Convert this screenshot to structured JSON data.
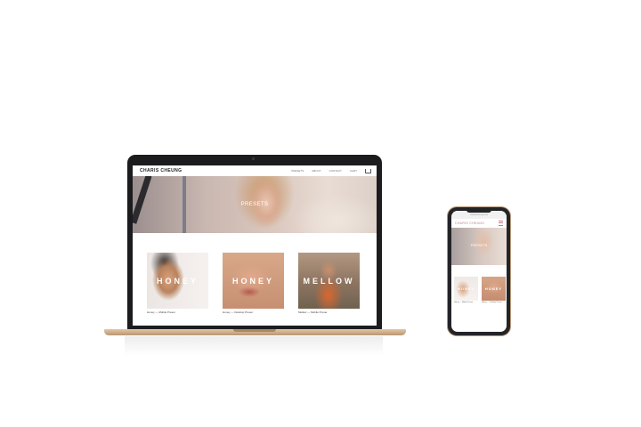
{
  "laptop": {
    "site": {
      "logo": "CHARIS CHEUNG",
      "nav": [
        "PRESETS",
        "ABOUT",
        "CONTACT",
        "CART"
      ],
      "hero_title": "PRESETS",
      "products": [
        {
          "word": "HONEY",
          "caption": "Honey — Mobile Preset"
        },
        {
          "word": "HONEY",
          "caption": "Honey — Desktop Preset"
        },
        {
          "word": "MELLOW",
          "caption": "Mellow — Mobile Preset"
        }
      ]
    }
  },
  "phone": {
    "url": "charischeung.com",
    "logo": "CHARIS CHEUNG",
    "hero_title": "PRESETS",
    "products": [
      {
        "word": "HONEY",
        "caption": "Honey — Mobile Preset"
      },
      {
        "word": "HONEY",
        "caption": "Honey — Desktop Preset"
      }
    ]
  },
  "icons": {
    "cart": "cart-icon",
    "menu": "hamburger-menu-icon"
  }
}
